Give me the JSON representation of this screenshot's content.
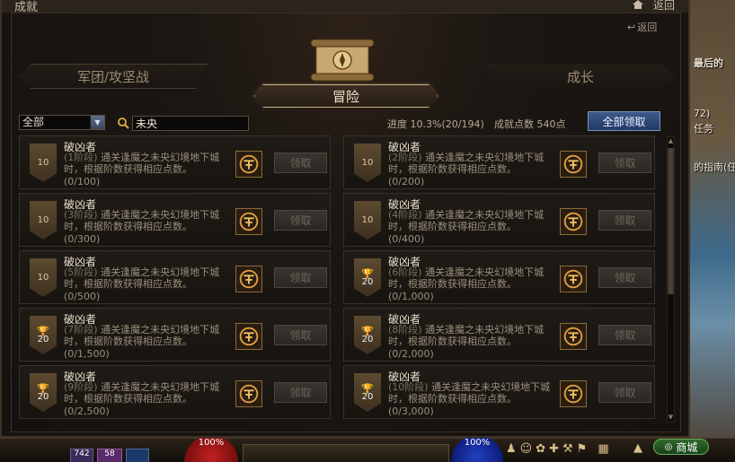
{
  "window": {
    "title": "成就",
    "back_label": "返回"
  },
  "header": {
    "back_label": "返回"
  },
  "tabs": [
    {
      "label": "军团/攻坚战",
      "active": false
    },
    {
      "label": "冒险",
      "active": true
    },
    {
      "label": "成长",
      "active": false
    }
  ],
  "filter": {
    "selected": "全部"
  },
  "search": {
    "value": "未央"
  },
  "summary": {
    "progress_label": "进度",
    "progress_value": "10.3%",
    "progress_count": "(20/194)",
    "progress_fraction": 0.103,
    "points_label": "成就点数",
    "points_value": "540点",
    "claim_all_label": "全部领取"
  },
  "achievements": [
    {
      "title": "破凶者",
      "stage": "(1阶段)",
      "desc": "通关逢魔之未央幻境地下城时，根据阶数获得相应点数。",
      "progress": "(0/100)",
      "points": "10",
      "trophy": false,
      "claim_label": "领取"
    },
    {
      "title": "破凶者",
      "stage": "(2阶段)",
      "desc": "通关逢魔之未央幻境地下城时，根据阶数获得相应点数。",
      "progress": "(0/200)",
      "points": "10",
      "trophy": false,
      "claim_label": "领取"
    },
    {
      "title": "破凶者",
      "stage": "(3阶段)",
      "desc": "通关逢魔之未央幻境地下城时，根据阶数获得相应点数。",
      "progress": "(0/300)",
      "points": "10",
      "trophy": false,
      "claim_label": "领取"
    },
    {
      "title": "破凶者",
      "stage": "(4阶段)",
      "desc": "通关逢魔之未央幻境地下城时，根据阶数获得相应点数。",
      "progress": "(0/400)",
      "points": "10",
      "trophy": false,
      "claim_label": "领取"
    },
    {
      "title": "破凶者",
      "stage": "(5阶段)",
      "desc": "通关逢魔之未央幻境地下城时，根据阶数获得相应点数。",
      "progress": "(0/500)",
      "points": "10",
      "trophy": false,
      "claim_label": "领取"
    },
    {
      "title": "破凶者",
      "stage": "(6阶段)",
      "desc": "通关逢魔之未央幻境地下城时，根据阶数获得相应点数。",
      "progress": "(0/1,000)",
      "points": "20",
      "trophy": true,
      "claim_label": "领取"
    },
    {
      "title": "破凶者",
      "stage": "(7阶段)",
      "desc": "通关逢魔之未央幻境地下城时，根据阶数获得相应点数。",
      "progress": "(0/1,500)",
      "points": "20",
      "trophy": true,
      "claim_label": "领取"
    },
    {
      "title": "破凶者",
      "stage": "(8阶段)",
      "desc": "通关逢魔之未央幻境地下城时，根据阶数获得相应点数。",
      "progress": "(0/2,000)",
      "points": "20",
      "trophy": true,
      "claim_label": "领取"
    },
    {
      "title": "破凶者",
      "stage": "(9阶段)",
      "desc": "通关逢魔之未央幻境地下城时，根据阶数获得相应点数。",
      "progress": "(0/2,500)",
      "points": "20",
      "trophy": true,
      "claim_label": "领取"
    },
    {
      "title": "破凶者",
      "stage": "(10阶段)",
      "desc": "通关逢魔之未央幻境地下城时，根据阶数获得相应点数。",
      "progress": "(0/3,000)",
      "points": "20",
      "trophy": true,
      "claim_label": "领取"
    }
  ],
  "side_panel": {
    "line1": "最后的",
    "line2": "72)",
    "line3": "任务",
    "line4": "的指南(任"
  },
  "bottom_bar": {
    "hp_left": "100%",
    "hp_right": "100%",
    "shop_label": "商城",
    "slot1": "742",
    "slot2": "58"
  },
  "colors": {
    "accent": "#c9b48a",
    "claim_all_bg": "#2c4a7a",
    "window_bg": "#17130f"
  }
}
